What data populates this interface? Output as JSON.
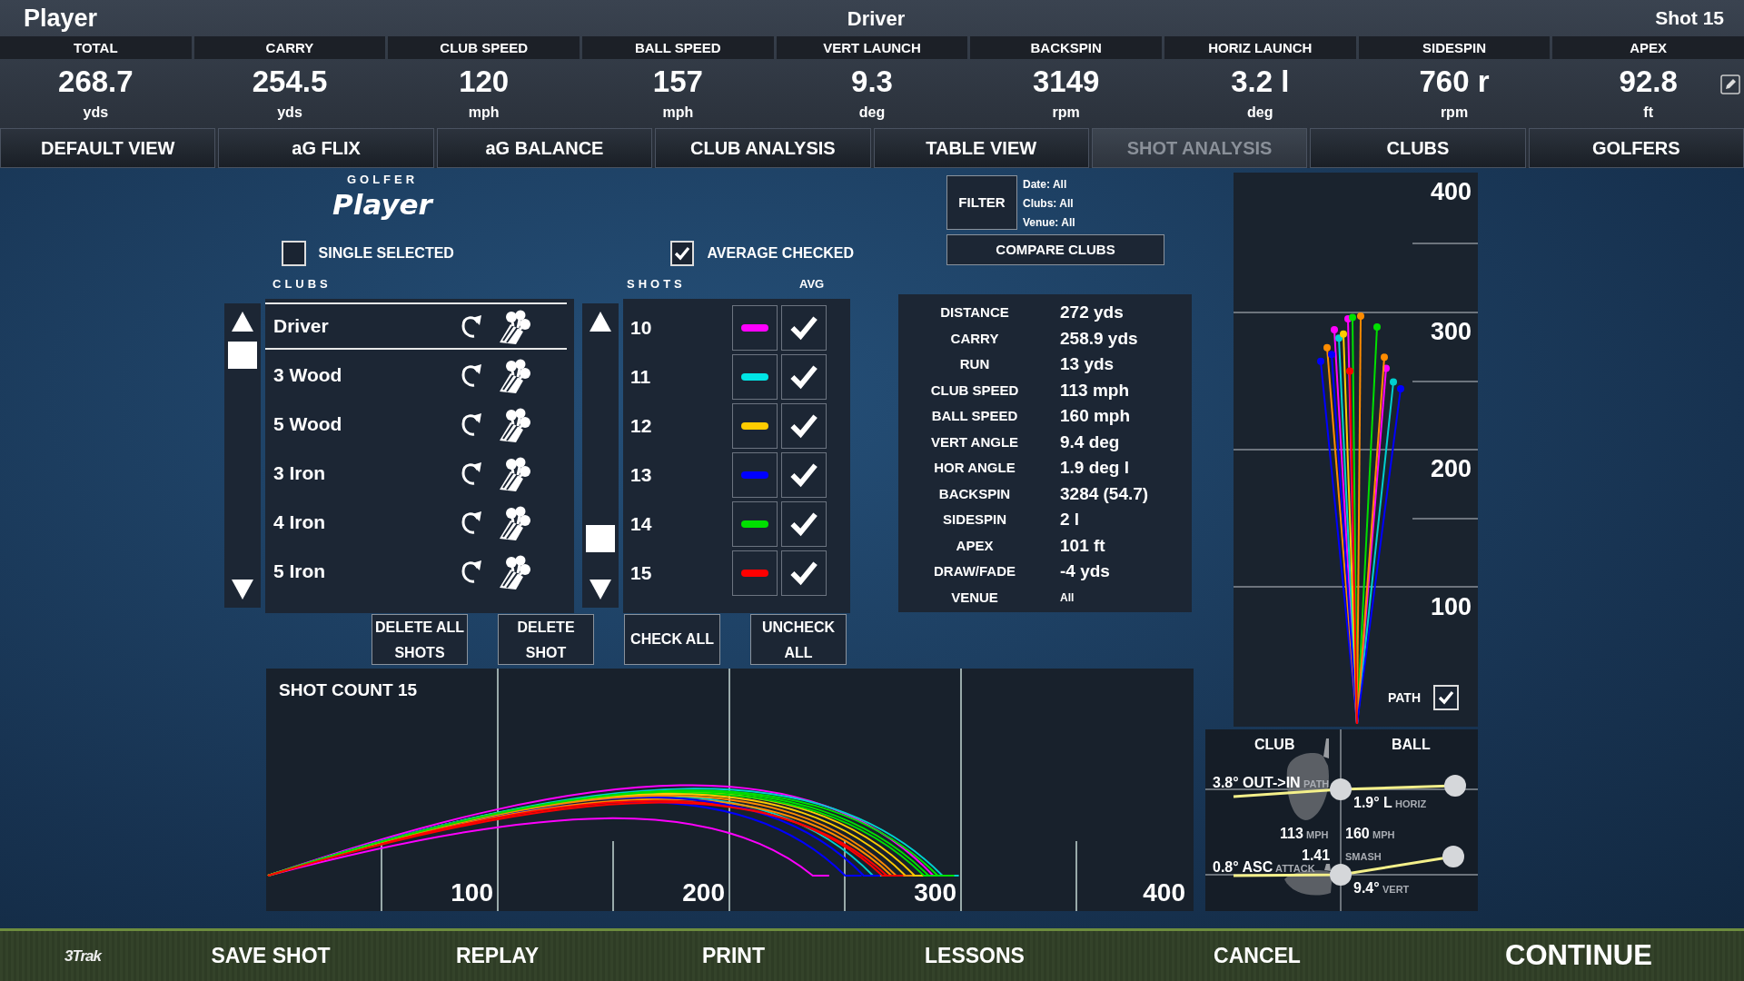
{
  "header": {
    "golfer": "Player",
    "club": "Driver",
    "shot": "Shot 15"
  },
  "stats": [
    {
      "label": "TOTAL",
      "value": "268.7",
      "unit": "yds"
    },
    {
      "label": "CARRY",
      "value": "254.5",
      "unit": "yds"
    },
    {
      "label": "CLUB SPEED",
      "value": "120",
      "unit": "mph"
    },
    {
      "label": "BALL SPEED",
      "value": "157",
      "unit": "mph"
    },
    {
      "label": "VERT LAUNCH",
      "value": "9.3",
      "unit": "deg"
    },
    {
      "label": "BACKSPIN",
      "value": "3149",
      "unit": "rpm"
    },
    {
      "label": "HORIZ LAUNCH",
      "value": "3.2 l",
      "unit": "deg"
    },
    {
      "label": "SIDESPIN",
      "value": "760 r",
      "unit": "rpm"
    },
    {
      "label": "APEX",
      "value": "92.8",
      "unit": "ft"
    }
  ],
  "tabs": [
    {
      "label": "DEFAULT VIEW",
      "selected": false
    },
    {
      "label": "aG FLIX",
      "selected": false
    },
    {
      "label": "aG BALANCE",
      "selected": false
    },
    {
      "label": "CLUB ANALYSIS",
      "selected": false
    },
    {
      "label": "TABLE VIEW",
      "selected": false
    },
    {
      "label": "SHOT ANALYSIS",
      "selected": true
    },
    {
      "label": "CLUBS",
      "selected": false
    },
    {
      "label": "GOLFERS",
      "selected": false
    }
  ],
  "golfer": {
    "caption": "GOLFER",
    "name": "Player"
  },
  "options": [
    {
      "label": "SINGLE SELECTED",
      "checked": false
    },
    {
      "label": "AVERAGE CHECKED",
      "checked": true
    }
  ],
  "clubs": {
    "heading": "CLUBS",
    "items": [
      {
        "name": "Driver",
        "selected": true
      },
      {
        "name": "3 Wood",
        "selected": false
      },
      {
        "name": "5 Wood",
        "selected": false
      },
      {
        "name": "3 Iron",
        "selected": false
      },
      {
        "name": "4 Iron",
        "selected": false
      },
      {
        "name": "5 Iron",
        "selected": false
      }
    ]
  },
  "shots": {
    "heading": "SHOTS",
    "avg_heading": "AVG",
    "items": [
      {
        "number": "10",
        "color": "#ff00ff",
        "checked": true
      },
      {
        "number": "11",
        "color": "#00e5e5",
        "checked": true
      },
      {
        "number": "12",
        "color": "#ffcc00",
        "checked": true
      },
      {
        "number": "13",
        "color": "#0000ff",
        "checked": true
      },
      {
        "number": "14",
        "color": "#00e000",
        "checked": true
      },
      {
        "number": "15",
        "color": "#ff0000",
        "checked": true
      }
    ]
  },
  "actions": [
    "DELETE ALL SHOTS",
    "DELETE SHOT",
    "CHECK ALL",
    "UNCHECK ALL"
  ],
  "filter": {
    "button": "FILTER",
    "lines": [
      "Date: All",
      "Clubs:  All",
      "Venue: All"
    ]
  },
  "compare_button": "COMPARE CLUBS",
  "summary": [
    {
      "label": "DISTANCE",
      "value": "272 yds",
      "kind": "value"
    },
    {
      "label": "CARRY",
      "value": "258.9 yds",
      "kind": "value"
    },
    {
      "label": "RUN",
      "value": "13 yds",
      "kind": "value"
    },
    {
      "label": "CLUB SPEED",
      "value": "113 mph",
      "kind": "value"
    },
    {
      "label": "BALL SPEED",
      "value": "160 mph",
      "kind": "value"
    },
    {
      "label": "VERT ANGLE",
      "value": "9.4 deg",
      "kind": "value"
    },
    {
      "label": "HOR ANGLE",
      "value": "1.9 deg l",
      "kind": "value"
    },
    {
      "label": "BACKSPIN",
      "value": "3284 (54.7)",
      "kind": "value"
    },
    {
      "label": "SIDESPIN",
      "value": "2 l",
      "kind": "value"
    },
    {
      "label": "APEX",
      "value": "101 ft",
      "kind": "value"
    },
    {
      "label": "DRAW/FADE",
      "value": "-4 yds",
      "kind": "value"
    },
    {
      "label": "VENUE",
      "value": "All",
      "kind": "small"
    }
  ],
  "dispersion": {
    "ticks": [
      "400",
      "300",
      "200",
      "100"
    ],
    "path_label": "PATH",
    "path_checked": true
  },
  "delivery": {
    "headings": [
      "CLUB",
      "BALL"
    ],
    "readings": [
      {
        "value": "3.8° OUT->IN",
        "unit": "PATH"
      },
      {
        "value": "1.9° L",
        "unit": "HORIZ"
      },
      {
        "value": "113",
        "unit": "MPH"
      },
      {
        "value": "160",
        "unit": "MPH"
      },
      {
        "value": "1.41",
        "unit": "SMASH"
      },
      {
        "value": "0.8° ASC",
        "unit": "ATTACK"
      },
      {
        "value": "9.4°",
        "unit": "VERT"
      }
    ]
  },
  "trajectory": {
    "title": "SHOT COUNT 15",
    "ticks": [
      "100",
      "200",
      "300",
      "400"
    ]
  },
  "footer": {
    "logo": "3Trak",
    "actions": [
      {
        "label": "SAVE SHOT",
        "kind": "action"
      },
      {
        "label": "REPLAY",
        "kind": "action"
      },
      {
        "label": "PRINT",
        "kind": "action"
      },
      {
        "label": "LESSONS",
        "kind": "action"
      },
      {
        "label": "CANCEL",
        "kind": "action"
      },
      {
        "label": "CONTINUE",
        "kind": "primary"
      }
    ]
  }
}
